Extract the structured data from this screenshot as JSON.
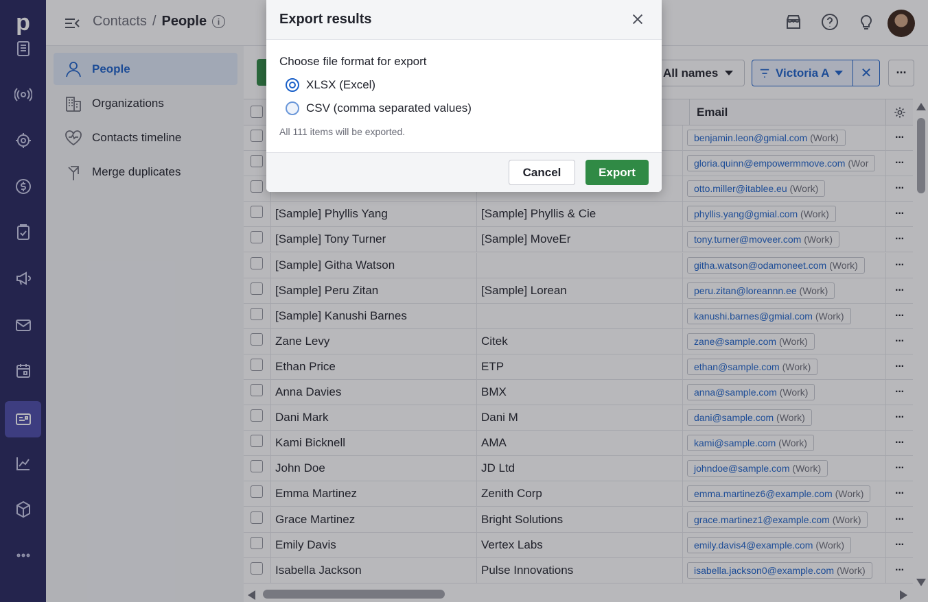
{
  "rail": {
    "logo": "p",
    "items": [
      {
        "name": "leads-inbox-icon"
      },
      {
        "name": "deals-icon"
      },
      {
        "name": "projects-icon"
      },
      {
        "name": "revenue-icon"
      },
      {
        "name": "activities-icon"
      },
      {
        "name": "campaigns-icon"
      },
      {
        "name": "mail-icon"
      },
      {
        "name": "calendar-icon"
      },
      {
        "name": "contacts-icon",
        "active": true
      },
      {
        "name": "insights-icon"
      },
      {
        "name": "products-icon"
      },
      {
        "name": "more-icon"
      }
    ]
  },
  "topbar": {
    "crumb_parent": "Contacts",
    "crumb_sep": "/",
    "crumb_current": "People",
    "info": "i"
  },
  "sidebar": {
    "items": [
      {
        "label": "People",
        "icon": "person-icon",
        "active": true
      },
      {
        "label": "Organizations",
        "icon": "building-icon"
      },
      {
        "label": "Contacts timeline",
        "icon": "heart-pulse-icon"
      },
      {
        "label": "Merge duplicates",
        "icon": "merge-icon"
      }
    ]
  },
  "toolbar": {
    "names_filter": "All names",
    "user_filter": "Victoria A",
    "clear_filter": "✕",
    "more": "···"
  },
  "table": {
    "email_header": "Email",
    "rows": [
      {
        "name": "",
        "org": "",
        "email": "benjamin.leon@gmial.com",
        "label": "(Work)"
      },
      {
        "name": "",
        "org": "",
        "email": "gloria.quinn@empowermmove.com",
        "label": "(Wor"
      },
      {
        "name": "",
        "org": "",
        "email": "otto.miller@itablee.eu",
        "label": "(Work)"
      },
      {
        "name": "[Sample] Phyllis Yang",
        "org": "[Sample] Phyllis & Cie",
        "email": "phyllis.yang@gmial.com",
        "label": "(Work)"
      },
      {
        "name": "[Sample] Tony Turner",
        "org": "[Sample] MoveEr",
        "email": "tony.turner@moveer.com",
        "label": "(Work)"
      },
      {
        "name": "[Sample] Githa Watson",
        "org": "",
        "email": "githa.watson@odamoneet.com",
        "label": "(Work)"
      },
      {
        "name": "[Sample] Peru Zitan",
        "org": "[Sample] Lorean",
        "email": "peru.zitan@loreannn.ee",
        "label": "(Work)"
      },
      {
        "name": "[Sample] Kanushi Barnes",
        "org": "",
        "email": "kanushi.barnes@gmial.com",
        "label": "(Work)"
      },
      {
        "name": "Zane Levy",
        "org": "Citek",
        "email": "zane@sample.com",
        "label": "(Work)"
      },
      {
        "name": "Ethan Price",
        "org": "ETP",
        "email": "ethan@sample.com",
        "label": "(Work)"
      },
      {
        "name": "Anna Davies",
        "org": "BMX",
        "email": "anna@sample.com",
        "label": "(Work)"
      },
      {
        "name": "Dani Mark",
        "org": "Dani M",
        "email": "dani@sample.com",
        "label": "(Work)"
      },
      {
        "name": "Kami Bicknell",
        "org": "AMA",
        "email": "kami@sample.com",
        "label": "(Work)"
      },
      {
        "name": "John Doe",
        "org": "JD Ltd",
        "email": "johndoe@sample.com",
        "label": "(Work)"
      },
      {
        "name": "Emma Martinez",
        "org": "Zenith Corp",
        "email": "emma.martinez6@example.com",
        "label": "(Work)"
      },
      {
        "name": "Grace Martinez",
        "org": "Bright Solutions",
        "email": "grace.martinez1@example.com",
        "label": "(Work)"
      },
      {
        "name": "Emily Davis",
        "org": "Vertex Labs",
        "email": "emily.davis4@example.com",
        "label": "(Work)"
      },
      {
        "name": "Isabella Jackson",
        "org": "Pulse Innovations",
        "email": "isabella.jackson0@example.com",
        "label": "(Work)"
      }
    ],
    "row_action": "···"
  },
  "modal": {
    "title": "Export results",
    "prompt": "Choose file format for export",
    "options": [
      {
        "label": "XLSX (Excel)",
        "checked": true
      },
      {
        "label": "CSV (comma separated values)",
        "checked": false
      }
    ],
    "note": "All 111 items will be exported.",
    "cancel_label": "Cancel",
    "export_label": "Export"
  },
  "colors": {
    "rail": "#26265d",
    "accent": "#1b61c9",
    "primary_button": "#308a45"
  }
}
